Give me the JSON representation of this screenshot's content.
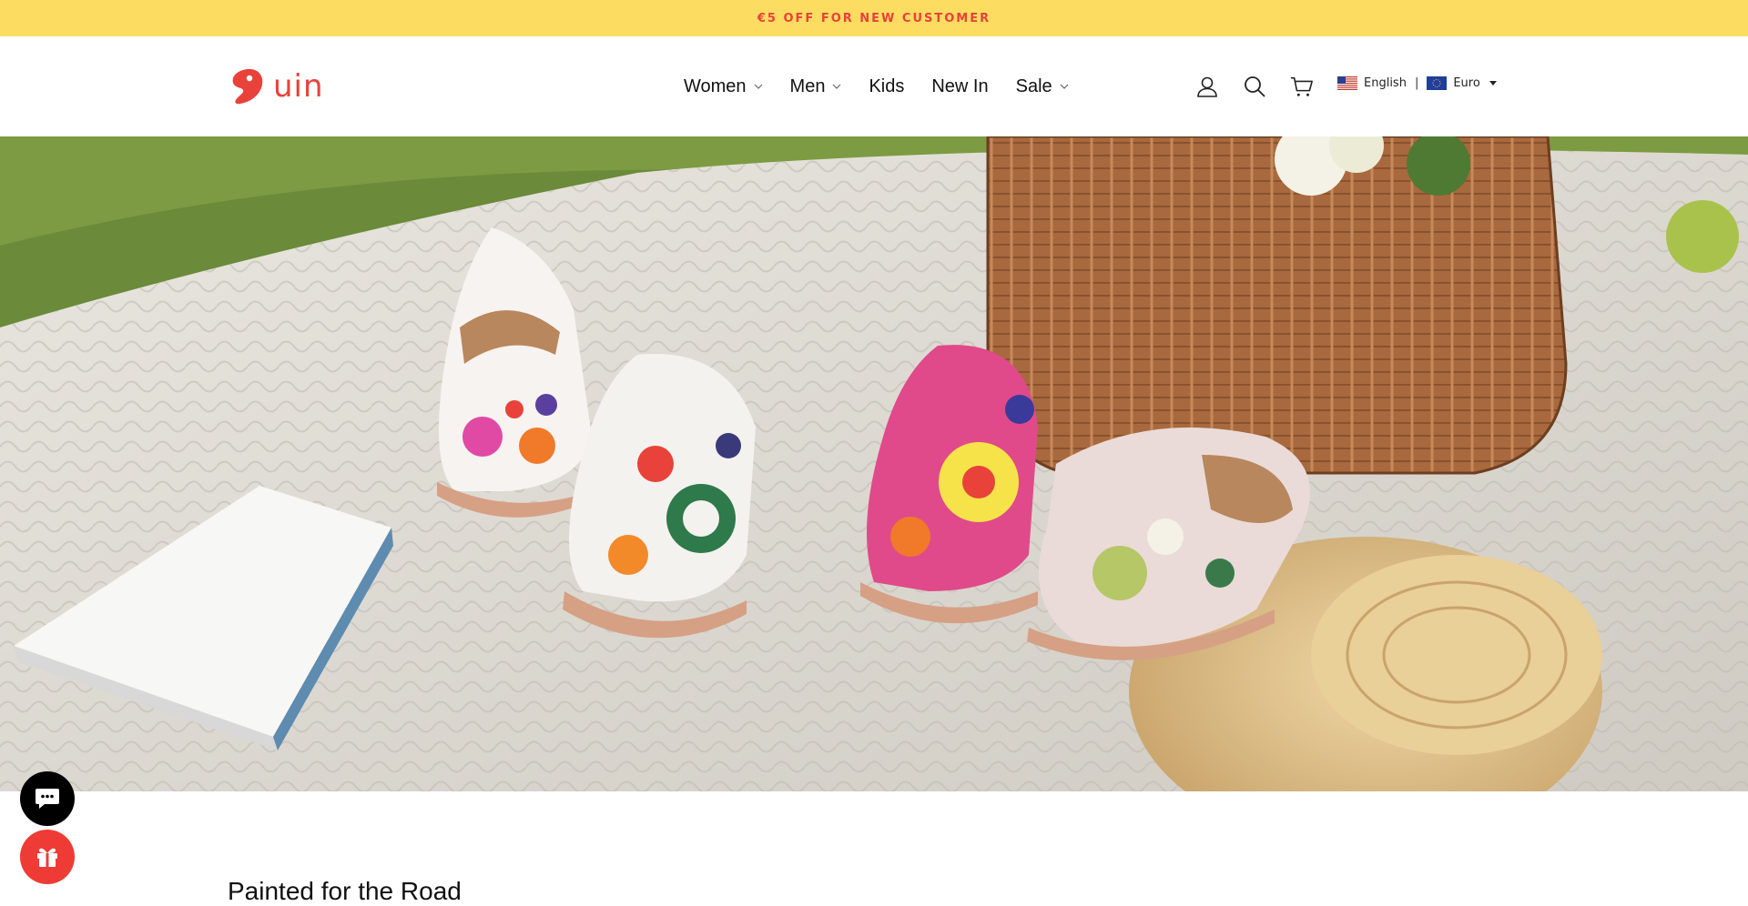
{
  "announcement": {
    "text": "€5 OFF FOR NEW CUSTOMER"
  },
  "header": {
    "logo_text": "uin",
    "nav": [
      {
        "label": "Women",
        "has_dropdown": true
      },
      {
        "label": "Men",
        "has_dropdown": true
      },
      {
        "label": "Kids",
        "has_dropdown": false
      },
      {
        "label": "New In",
        "has_dropdown": false
      },
      {
        "label": "Sale",
        "has_dropdown": true
      }
    ],
    "icons": [
      "account-icon",
      "search-icon",
      "cart-icon"
    ],
    "language": {
      "label": "English",
      "flag": "us-flag-icon"
    },
    "currency": {
      "label": "Euro",
      "flag": "eu-flag-icon"
    }
  },
  "hero": {
    "image": "painted-shoes-picnic-scene"
  },
  "section": {
    "title": "Painted for the Road"
  },
  "floating": {
    "chat": "chat-icon",
    "gift": "gift-icon"
  },
  "colors": {
    "announce_bg": "#fddc62",
    "brand_red": "#e8423a",
    "gift_red": "#ef3b35"
  }
}
